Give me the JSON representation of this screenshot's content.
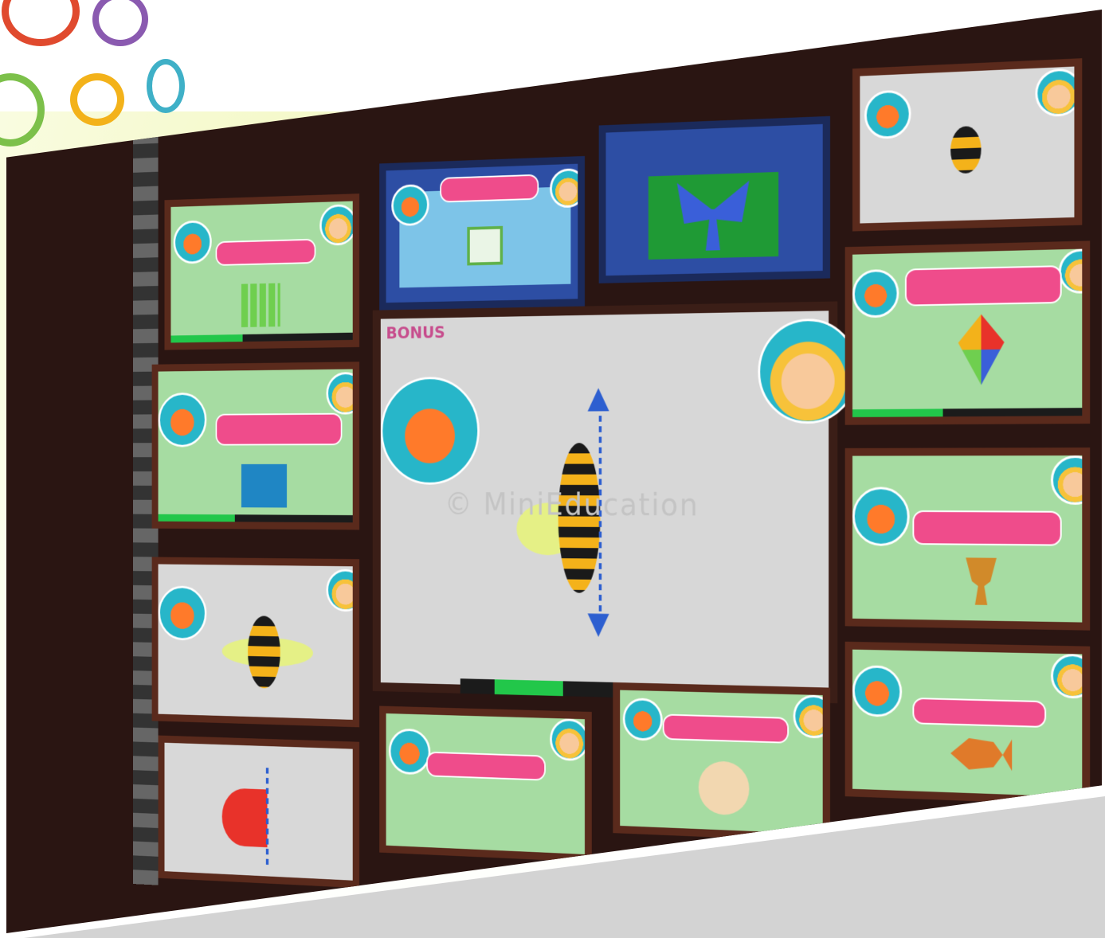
{
  "collage": {
    "center_slide": {
      "badge_text": "BONUS",
      "watermark_text": "© MiniEducation"
    }
  },
  "decorative_rings": [
    {
      "color": "#e04a2e"
    },
    {
      "color": "#8a5ab0"
    },
    {
      "color": "#7cc04a"
    },
    {
      "color": "#f3b21a"
    },
    {
      "color": "#3fb0c7"
    }
  ],
  "colors": {
    "slide_background": "#a6dca2",
    "slide_frame": "#5a2a1c",
    "pink_banner": "#ef4c8b",
    "blue_slide": "#2d4ea4"
  }
}
